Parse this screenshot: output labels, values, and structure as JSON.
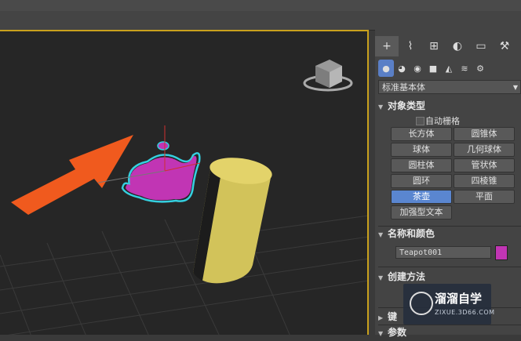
{
  "panel": {
    "dropdown_value": "标准基本体",
    "object_type": {
      "title": "对象类型",
      "autogrid_label": "自动栅格",
      "buttons": [
        "长方体",
        "圆锥体",
        "球体",
        "几何球体",
        "圆柱体",
        "管状体",
        "圆环",
        "四棱锥",
        "茶壶",
        "平面",
        "加强型文本"
      ],
      "active_button": "茶壶"
    },
    "name_color": {
      "title": "名称和颜色",
      "name_value": "Teapot001",
      "color": "#c135b4"
    },
    "creation_method": {
      "title": "创建方法"
    },
    "keyboard_entry": {
      "title": "键"
    },
    "parameters": {
      "title": "参数"
    }
  },
  "watermark": {
    "title": "溜溜自学",
    "url": "ZIXUE.3D66.COM"
  },
  "colors": {
    "viewport_border": "#c9a11d",
    "teapot": "#c135b4",
    "teapot_outline": "#35d0e0",
    "cylinder": "#d2c35a",
    "arrow": "#f05a1e",
    "active_button": "#5a86d0"
  },
  "icons": [
    "plus-icon",
    "curve-icon",
    "hierarchy-icon",
    "motion-icon",
    "display-icon",
    "wrench-icon",
    "geometry-icon",
    "shapes-icon",
    "light-icon",
    "camera-icon",
    "helper-icon",
    "spacewarp-icon",
    "systems-icon"
  ]
}
